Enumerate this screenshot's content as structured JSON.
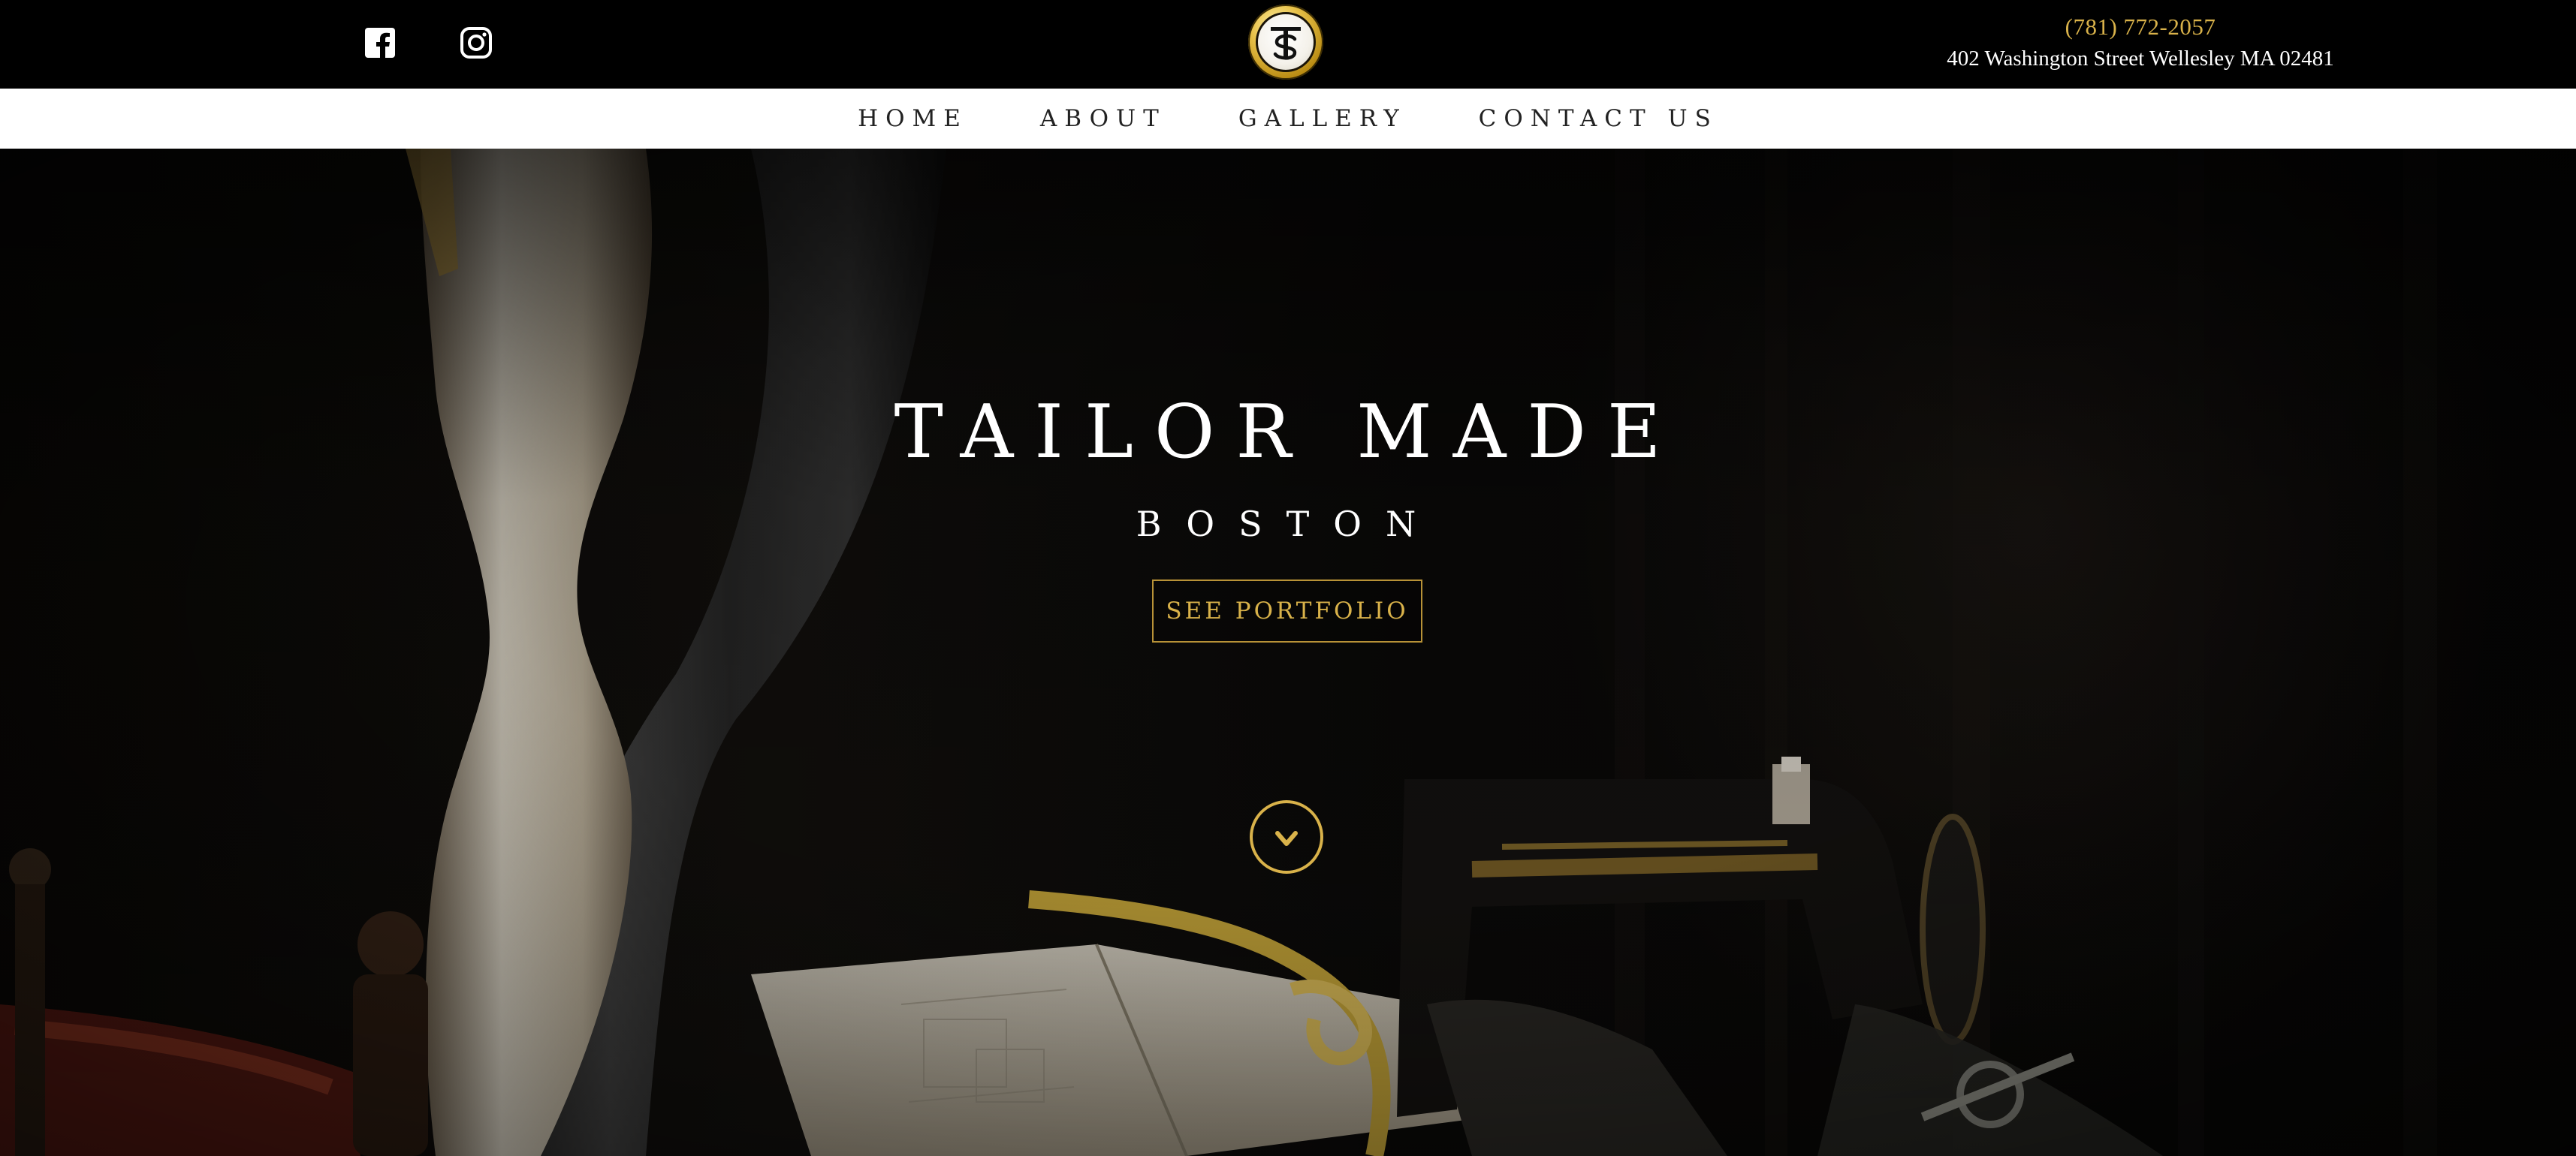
{
  "header": {
    "social": [
      {
        "name": "facebook",
        "icon": "facebook-icon"
      },
      {
        "name": "instagram",
        "icon": "instagram-icon"
      }
    ],
    "logo": {
      "letters": "TS",
      "icon": "ts-monogram-logo"
    },
    "phone": "(781) 772-2057",
    "address": "402 Washington Street Wellesley MA 02481"
  },
  "nav": {
    "items": [
      {
        "label": "HOME"
      },
      {
        "label": "ABOUT"
      },
      {
        "label": "GALLERY"
      },
      {
        "label": "CONTACT US"
      }
    ]
  },
  "hero": {
    "title": "TAILOR MADE",
    "subtitle": "BOSTON",
    "button_label": "SEE PORTFOLIO",
    "scroll_icon": "chevron-down-icon"
  },
  "colors": {
    "accent_gold": "#d9b24a",
    "nav_background": "#ffffff",
    "topbar_background": "#000000"
  }
}
